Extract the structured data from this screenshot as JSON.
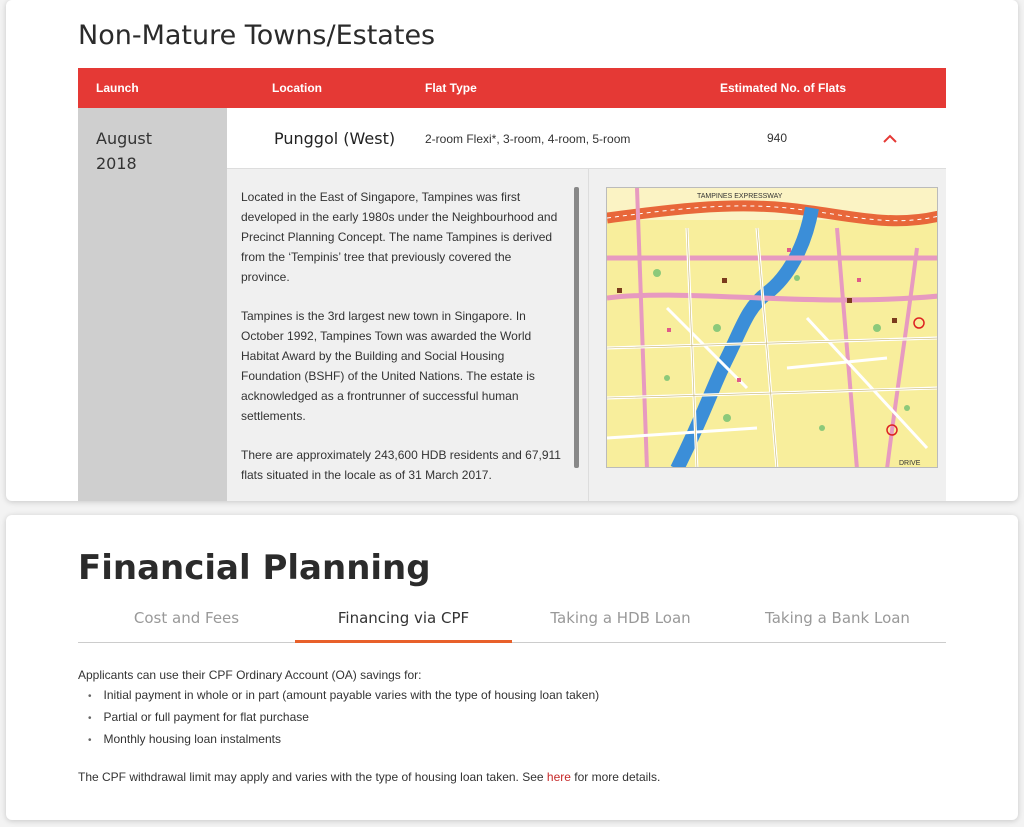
{
  "towns": {
    "title": "Non-Mature Towns/Estates",
    "headers": {
      "launch": "Launch",
      "location": "Location",
      "flat_type": "Flat Type",
      "estimated": "Estimated No. of Flats"
    },
    "row": {
      "launch_month": "August",
      "launch_year": "2018",
      "location": "Punggol (West)",
      "flat_type": "2-room Flexi*, 3-room, 4-room, 5-room",
      "count": "940",
      "expand_icon": "chevron-up-icon"
    },
    "description": [
      "Located in the East of Singapore, Tampines was first developed in the early 1980s under the Neighbourhood and Precinct Planning Concept. The name Tampines is derived from the ‘Tempinis’ tree that previously covered the province.",
      "Tampines is the 3rd largest new town in Singapore. In October 1992, Tampines Town was awarded the World Habitat Award by the Building and Social Housing Foundation (BSHF) of the United Nations. The estate is acknowledged as a frontrunner of successful human settlements.",
      "There are approximately 243,600 HDB residents and 67,911 flats situated in the locale as of 31 March 2017."
    ],
    "map_labels": {
      "expressway": "TAMPINES EXPRESSWAY",
      "drive": "DRIVE"
    }
  },
  "financial": {
    "title": "Financial Planning",
    "tabs": [
      {
        "label": "Cost and Fees"
      },
      {
        "label": "Financing via CPF"
      },
      {
        "label": "Taking a HDB Loan"
      },
      {
        "label": "Taking a Bank Loan"
      }
    ],
    "active_tab": "Financing via CPF",
    "intro": "Applicants can use their CPF Ordinary Account (OA) savings for:",
    "bullets": [
      "Initial payment in whole or in part (amount payable varies with the type of housing loan taken)",
      "Partial or full payment for flat purchase",
      "Monthly housing loan instalments"
    ],
    "note_before": "The CPF withdrawal limit may apply and varies with the type of housing loan taken. See ",
    "note_link": "here",
    "note_after": " for more details."
  },
  "colors": {
    "header_red": "#e53935",
    "tab_accent": "#e8602a",
    "link": "#c62828"
  }
}
